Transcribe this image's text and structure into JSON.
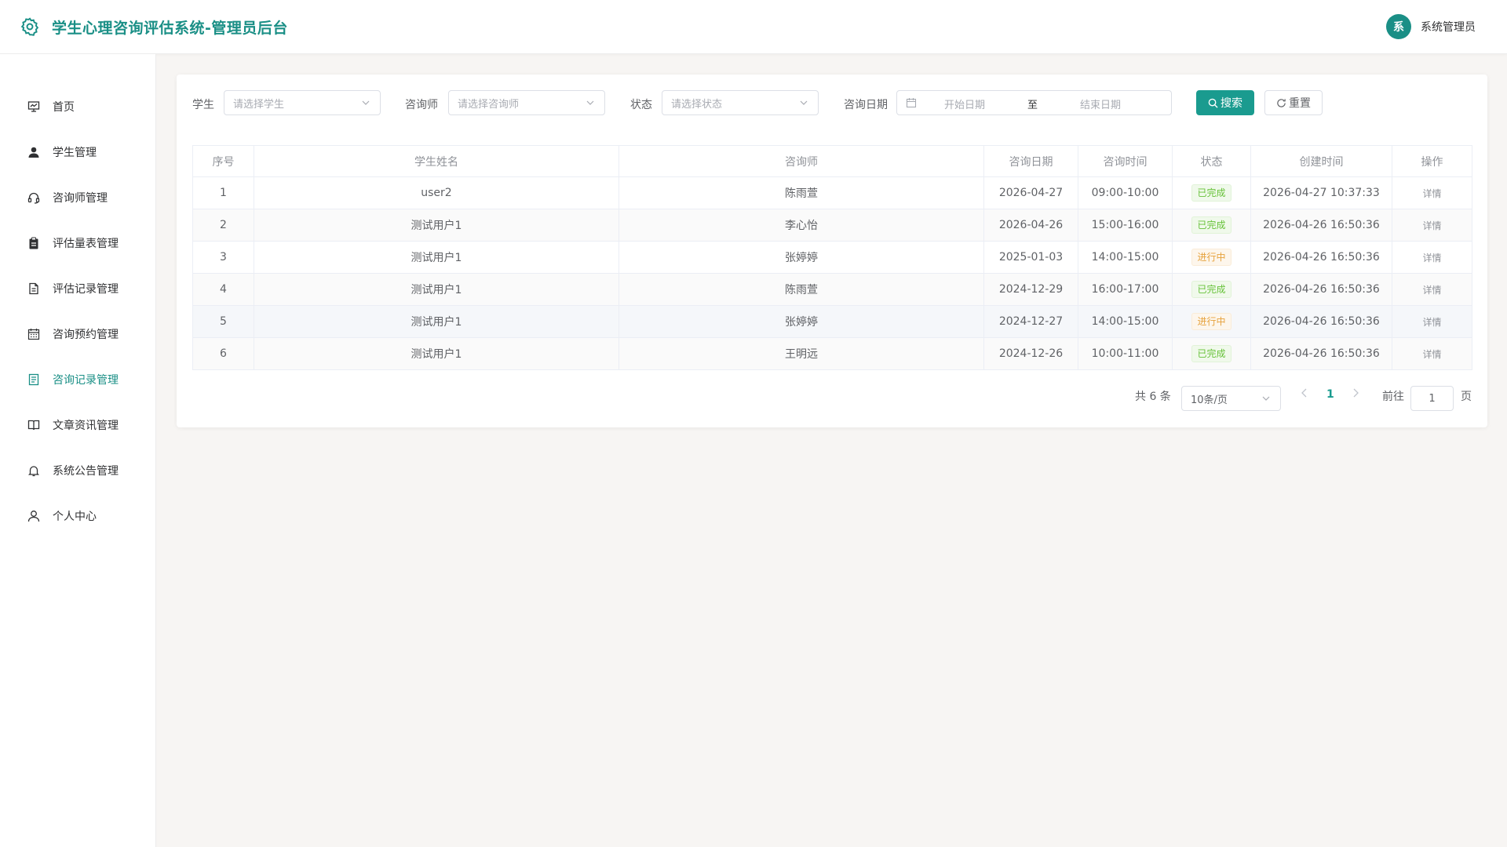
{
  "app": {
    "title": "学生心理咨询评估系统-管理员后台",
    "user_avatar_char": "系",
    "user_name": "系统管理员",
    "accent_color": "#1a8f86"
  },
  "sidebar": {
    "items": [
      {
        "label": "首页",
        "icon": "monitor-chart-icon",
        "active": false
      },
      {
        "label": "学生管理",
        "icon": "user-filled-icon",
        "active": false
      },
      {
        "label": "咨询师管理",
        "icon": "headset-icon",
        "active": false
      },
      {
        "label": "评估量表管理",
        "icon": "clipboard-icon",
        "active": false
      },
      {
        "label": "评估记录管理",
        "icon": "document-icon",
        "active": false
      },
      {
        "label": "咨询预约管理",
        "icon": "calendar-icon",
        "active": false
      },
      {
        "label": "咨询记录管理",
        "icon": "tickets-icon",
        "active": true
      },
      {
        "label": "文章资讯管理",
        "icon": "book-icon",
        "active": false
      },
      {
        "label": "系统公告管理",
        "icon": "bell-icon",
        "active": false
      },
      {
        "label": "个人中心",
        "icon": "user-outline-icon",
        "active": false
      }
    ]
  },
  "filters": {
    "student_label": "学生",
    "student_placeholder": "请选择学生",
    "counselor_label": "咨询师",
    "counselor_placeholder": "请选择咨询师",
    "status_label": "状态",
    "status_placeholder": "请选择状态",
    "date_label": "咨询日期",
    "date_start_placeholder": "开始日期",
    "date_separator": "至",
    "date_end_placeholder": "结束日期",
    "search_button": "搜索",
    "reset_button": "重置"
  },
  "table": {
    "columns": [
      "序号",
      "学生姓名",
      "咨询师",
      "咨询日期",
      "咨询时间",
      "状态",
      "创建时间",
      "操作"
    ],
    "rows": [
      {
        "index": "1",
        "student": "user2",
        "counselor": "陈雨萱",
        "date": "2026-04-27",
        "time": "09:00-10:00",
        "status": "已完成",
        "created": "2026-04-27 10:37:33",
        "action": "详情"
      },
      {
        "index": "2",
        "student": "测试用户1",
        "counselor": "李心怡",
        "date": "2026-04-26",
        "time": "15:00-16:00",
        "status": "已完成",
        "created": "2026-04-26 16:50:36",
        "action": "详情"
      },
      {
        "index": "3",
        "student": "测试用户1",
        "counselor": "张婷婷",
        "date": "2025-01-03",
        "time": "14:00-15:00",
        "status": "进行中",
        "created": "2026-04-26 16:50:36",
        "action": "详情"
      },
      {
        "index": "4",
        "student": "测试用户1",
        "counselor": "陈雨萱",
        "date": "2024-12-29",
        "time": "16:00-17:00",
        "status": "已完成",
        "created": "2026-04-26 16:50:36",
        "action": "详情"
      },
      {
        "index": "5",
        "student": "测试用户1",
        "counselor": "张婷婷",
        "date": "2024-12-27",
        "time": "14:00-15:00",
        "status": "进行中",
        "created": "2026-04-26 16:50:36",
        "action": "详情"
      },
      {
        "index": "6",
        "student": "测试用户1",
        "counselor": "王明远",
        "date": "2024-12-26",
        "time": "10:00-11:00",
        "status": "已完成",
        "created": "2026-04-26 16:50:36",
        "action": "详情"
      }
    ]
  },
  "pagination": {
    "total_text": "共 6 条",
    "page_size": "10条/页",
    "current_page": "1",
    "goto_label": "前往",
    "goto_value": "1",
    "page_unit": "页"
  }
}
